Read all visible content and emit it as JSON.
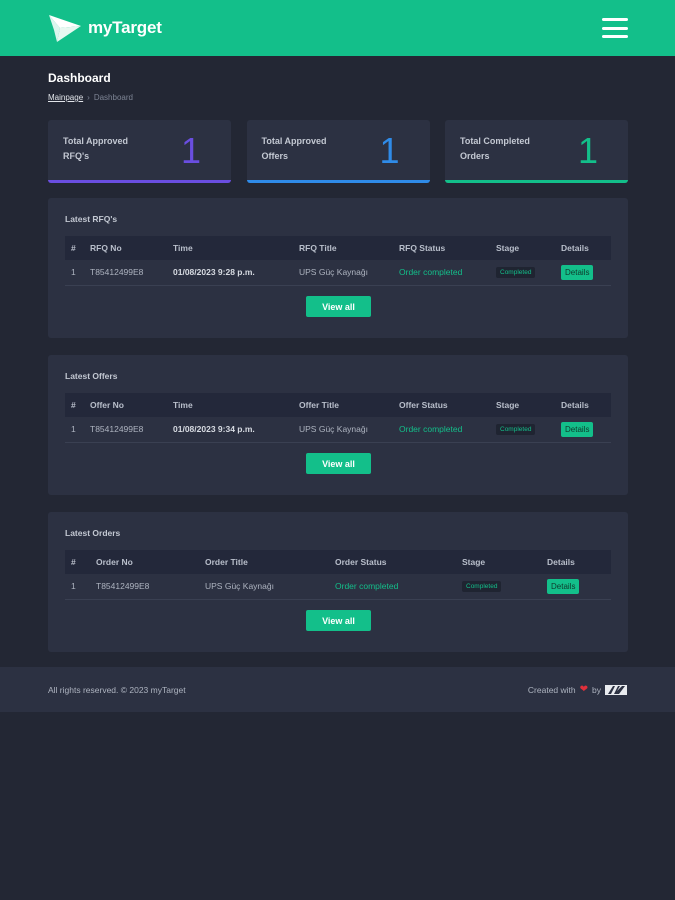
{
  "header": {
    "brand_name": "myTarget",
    "logo_icon": "paper-plane-logo",
    "menu_icon": "hamburger-menu-icon",
    "brand_color": "#13bf8a"
  },
  "page": {
    "title": "Dashboard",
    "breadcrumb": {
      "home": "Mainpage",
      "separator": "›",
      "current": "Dashboard"
    }
  },
  "stats": [
    {
      "label": "Total Approved RFQ's",
      "value": "1",
      "color": "#6a4ee0"
    },
    {
      "label": "Total Approved Offers",
      "value": "1",
      "color": "#2f8be8"
    },
    {
      "label": "Total Completed Orders",
      "value": "1",
      "color": "#13bf8a"
    }
  ],
  "rfqs": {
    "title": "Latest RFQ's",
    "columns": [
      "#",
      "RFQ No",
      "Time",
      "RFQ Title",
      "RFQ Status",
      "Stage",
      "Details"
    ],
    "rows": [
      {
        "num": "1",
        "no": "T85412499E8",
        "time": "01/08/2023 9:28 p.m.",
        "title": "UPS Güç Kaynağı",
        "status": "Order completed",
        "stage": "Completed",
        "details": "Details"
      }
    ],
    "view_all": "View all"
  },
  "offers": {
    "title": "Latest Offers",
    "columns": [
      "#",
      "Offer No",
      "Time",
      "Offer Title",
      "Offer Status",
      "Stage",
      "Details"
    ],
    "rows": [
      {
        "num": "1",
        "no": "T85412499E8",
        "time": "01/08/2023 9:34 p.m.",
        "title": "UPS Güç Kaynağı",
        "status": "Order completed",
        "stage": "Completed",
        "details": "Details"
      }
    ],
    "view_all": "View all"
  },
  "orders": {
    "title": "Latest Orders",
    "columns": [
      "#",
      "Order No",
      "Order Title",
      "Order Status",
      "Stage",
      "Details"
    ],
    "rows": [
      {
        "num": "1",
        "no": "T85412499E8",
        "title": "UPS Güç Kaynağı",
        "status": "Order completed",
        "stage": "Completed",
        "details": "Details"
      }
    ],
    "view_all": "View all"
  },
  "footer": {
    "copyright": "All rights reserved. © 2023 myTarget",
    "created_with": "Created with",
    "heart": "❤",
    "by": "by"
  }
}
